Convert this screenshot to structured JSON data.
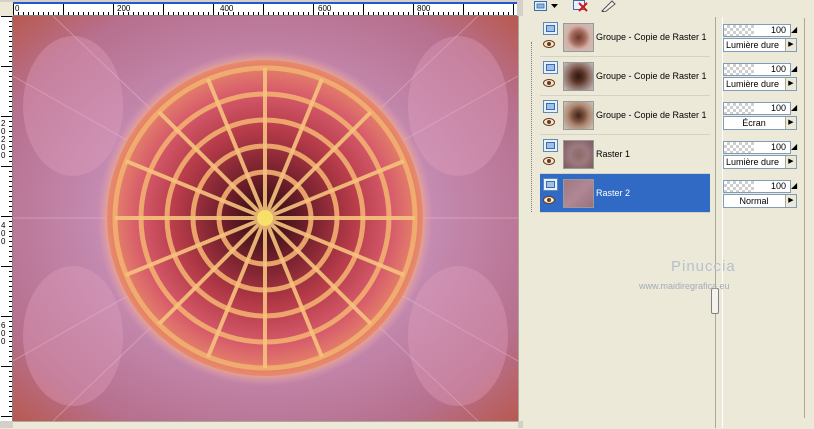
{
  "ruler": {
    "top_labels": [
      "0",
      "200",
      "400",
      "600",
      "800"
    ],
    "left_labels": [
      "2",
      "0",
      "2",
      "0",
      "0",
      "4",
      "0",
      "0",
      "6",
      "0",
      "0"
    ]
  },
  "layers_toolbar": {
    "icons": [
      "new-layer-icon",
      "dropdown-arrow-icon",
      "delete-layer-icon",
      "edit-layer-icon"
    ]
  },
  "layers": [
    {
      "name": "Groupe - Copie de Raster 1",
      "opacity": "100",
      "blend": "Lumière dure",
      "selected": false,
      "thumb": "mandala-pink"
    },
    {
      "name": "Groupe - Copie de Raster 1",
      "opacity": "100",
      "blend": "Lumière dure",
      "selected": false,
      "thumb": "mandala-dark"
    },
    {
      "name": "Groupe - Copie de Raster 1",
      "opacity": "100",
      "blend": "Écran",
      "selected": false,
      "thumb": "mandala-cross"
    },
    {
      "name": "Raster 1",
      "opacity": "100",
      "blend": "Lumière dure",
      "selected": false,
      "thumb": "texture"
    },
    {
      "name": "Raster 2",
      "opacity": "100",
      "blend": "Normal",
      "selected": true,
      "thumb": "mauve"
    }
  ],
  "watermark": {
    "title": "Pinuccia",
    "url": "www.maidiregrafica.eu"
  },
  "colors": {
    "selection": "#316ac5",
    "panel_bg": "#ece9d8",
    "ruler_accent": "#2458c9"
  }
}
